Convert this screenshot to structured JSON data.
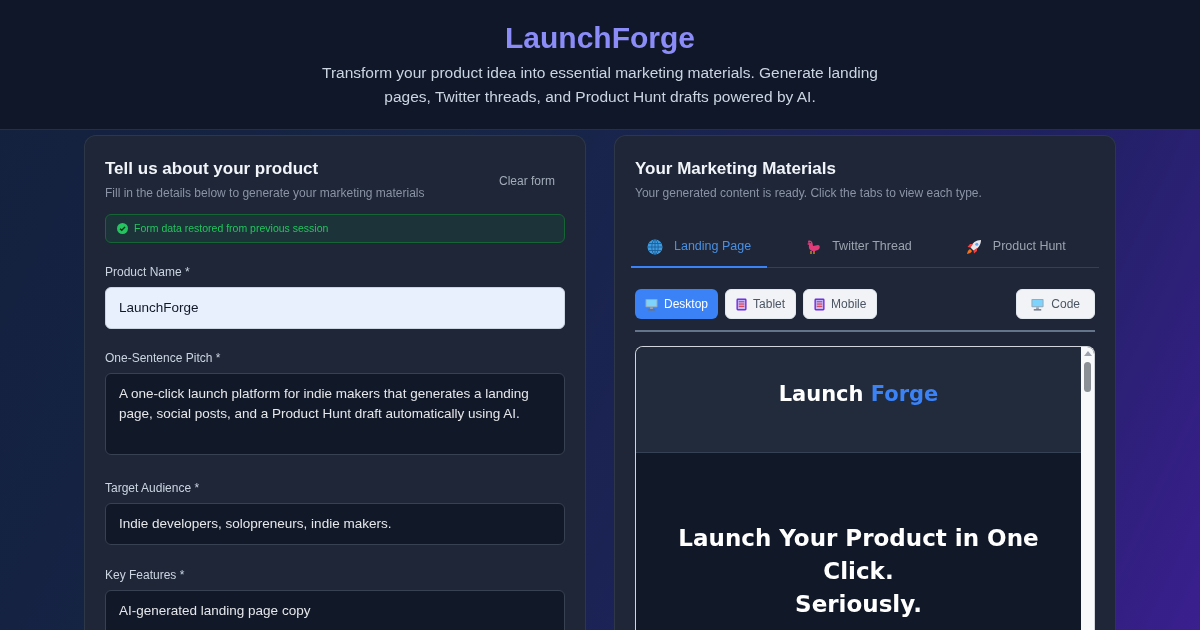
{
  "header": {
    "title": "LaunchForge",
    "subtitle": "Transform your product idea into essential marketing materials. Generate landing pages, Twitter threads, and Product Hunt drafts powered by AI."
  },
  "form": {
    "title": "Tell us about your product",
    "subtitle": "Fill in the details below to generate your marketing materials",
    "clear_button": "Clear form",
    "notice": {
      "kind": "success",
      "text": "Form data restored from previous session"
    },
    "fields": [
      {
        "label": "Product Name *",
        "kind": "input",
        "value": "LaunchForge",
        "autofilled": true
      },
      {
        "label": "One-Sentence Pitch *",
        "kind": "textarea",
        "value": "A one-click launch platform for indie makers that generates a landing page, social posts, and a Product Hunt draft automatically using AI.",
        "autofilled": false
      },
      {
        "label": "Target Audience *",
        "kind": "input",
        "value": "Indie developers, solopreneurs, indie makers.",
        "autofilled": false
      },
      {
        "label": "Key Features *",
        "kind": "textarea",
        "value": "AI-generated landing page copy",
        "autofilled": false
      }
    ]
  },
  "output": {
    "title": "Your Marketing Materials",
    "subtitle": "Your generated content is ready. Click the tabs to view each type.",
    "tabs": [
      {
        "label": "Landing Page",
        "selected": true
      },
      {
        "label": "Twitter Thread",
        "selected": false
      },
      {
        "label": "Product Hunt",
        "selected": false
      }
    ],
    "view_buttons": [
      {
        "label": "Desktop",
        "selected": true
      },
      {
        "label": "Tablet",
        "selected": false
      },
      {
        "label": "Mobile",
        "selected": false
      }
    ],
    "code_button": {
      "label": "Code"
    },
    "preview": {
      "brand": "Launch",
      "brand_accent": "Forge",
      "headline": "Launch Your Product in One Click.\nSeriously."
    }
  }
}
